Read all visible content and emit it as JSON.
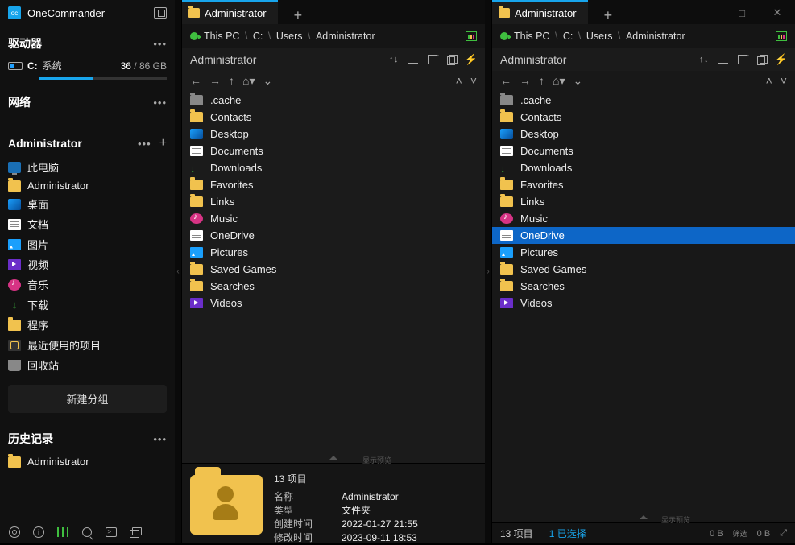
{
  "app": {
    "name": "OneCommander"
  },
  "sidebar": {
    "drives_header": "驱动器",
    "network_header": "网络",
    "favorites_header": "Administrator",
    "new_group": "新建分组",
    "history_header": "历史记录",
    "drive": {
      "letter": "C:",
      "label": "系统",
      "used": "36",
      "sep": " / ",
      "total": "86 GB"
    },
    "favorites": [
      {
        "icon": "monitor",
        "label": "此电脑"
      },
      {
        "icon": "folder",
        "label": "Administrator"
      },
      {
        "icon": "desktop",
        "label": "桌面"
      },
      {
        "icon": "doc",
        "label": "文档"
      },
      {
        "icon": "pic",
        "label": "图片"
      },
      {
        "icon": "vid",
        "label": "视频"
      },
      {
        "icon": "mus",
        "label": "音乐"
      },
      {
        "icon": "dl",
        "label": "下载"
      },
      {
        "icon": "folder",
        "label": "程序"
      },
      {
        "icon": "recent",
        "label": "最近使用的项目"
      },
      {
        "icon": "trash",
        "label": "回收站"
      }
    ],
    "history": [
      {
        "icon": "folder",
        "label": "Administrator"
      }
    ]
  },
  "panes": {
    "left": {
      "tab": "Administrator",
      "breadcrumb": [
        "This PC",
        "C:",
        "Users",
        "Administrator"
      ],
      "header": "Administrator",
      "files": [
        {
          "icon": "folder gray",
          "name": ".cache"
        },
        {
          "icon": "folder",
          "name": "Contacts"
        },
        {
          "icon": "desktop",
          "name": "Desktop"
        },
        {
          "icon": "doc",
          "name": "Documents"
        },
        {
          "icon": "dl",
          "name": "Downloads"
        },
        {
          "icon": "folder",
          "name": "Favorites"
        },
        {
          "icon": "folder",
          "name": "Links"
        },
        {
          "icon": "mus",
          "name": "Music"
        },
        {
          "icon": "doc",
          "name": "OneDrive"
        },
        {
          "icon": "pic",
          "name": "Pictures"
        },
        {
          "icon": "folder",
          "name": "Saved Games"
        },
        {
          "icon": "folder",
          "name": "Searches"
        },
        {
          "icon": "vid",
          "name": "Videos"
        }
      ],
      "details": {
        "count": "13 项目",
        "toggle": "显示预览",
        "rows": [
          {
            "k": "名称",
            "v": "Administrator"
          },
          {
            "k": "类型",
            "v": "文件夹"
          },
          {
            "k": "创建时间",
            "v": "2022-01-27  21:55"
          },
          {
            "k": "修改时间",
            "v": "2023-09-11  18:53"
          }
        ]
      }
    },
    "right": {
      "tab": "Administrator",
      "breadcrumb": [
        "This PC",
        "C:",
        "Users",
        "Administrator"
      ],
      "header": "Administrator",
      "selected_index": 8,
      "files": [
        {
          "icon": "folder gray",
          "name": ".cache"
        },
        {
          "icon": "folder",
          "name": "Contacts"
        },
        {
          "icon": "desktop",
          "name": "Desktop"
        },
        {
          "icon": "doc",
          "name": "Documents"
        },
        {
          "icon": "dl",
          "name": "Downloads"
        },
        {
          "icon": "folder",
          "name": "Favorites"
        },
        {
          "icon": "folder",
          "name": "Links"
        },
        {
          "icon": "mus",
          "name": "Music"
        },
        {
          "icon": "doc",
          "name": "OneDrive"
        },
        {
          "icon": "pic",
          "name": "Pictures"
        },
        {
          "icon": "folder",
          "name": "Saved Games"
        },
        {
          "icon": "folder",
          "name": "Searches"
        },
        {
          "icon": "vid",
          "name": "Videos"
        }
      ],
      "status": {
        "items": "13 项目",
        "selected": "1 已选择",
        "toggle": "显示预览",
        "size_a": "0 B",
        "size_b": "0 B",
        "filter": "筛选"
      }
    }
  }
}
